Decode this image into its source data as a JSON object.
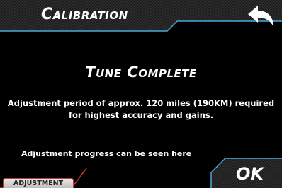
{
  "header": {
    "title": "Calibration",
    "back_icon": "back-arrow-icon"
  },
  "main": {
    "heading": "Tune Complete",
    "message": "Adjustment period of approx. 120 miles (190KM) required for highest accuracy and gains.",
    "hint": "Adjustment progress can be seen here"
  },
  "footer": {
    "adjustment_label": "ADJUSTMENT",
    "ok_label": "OK"
  },
  "colors": {
    "accent_blue": "#4aa8d8",
    "accent_red": "#c0392b",
    "bar_dark": "#2a2a2a"
  }
}
